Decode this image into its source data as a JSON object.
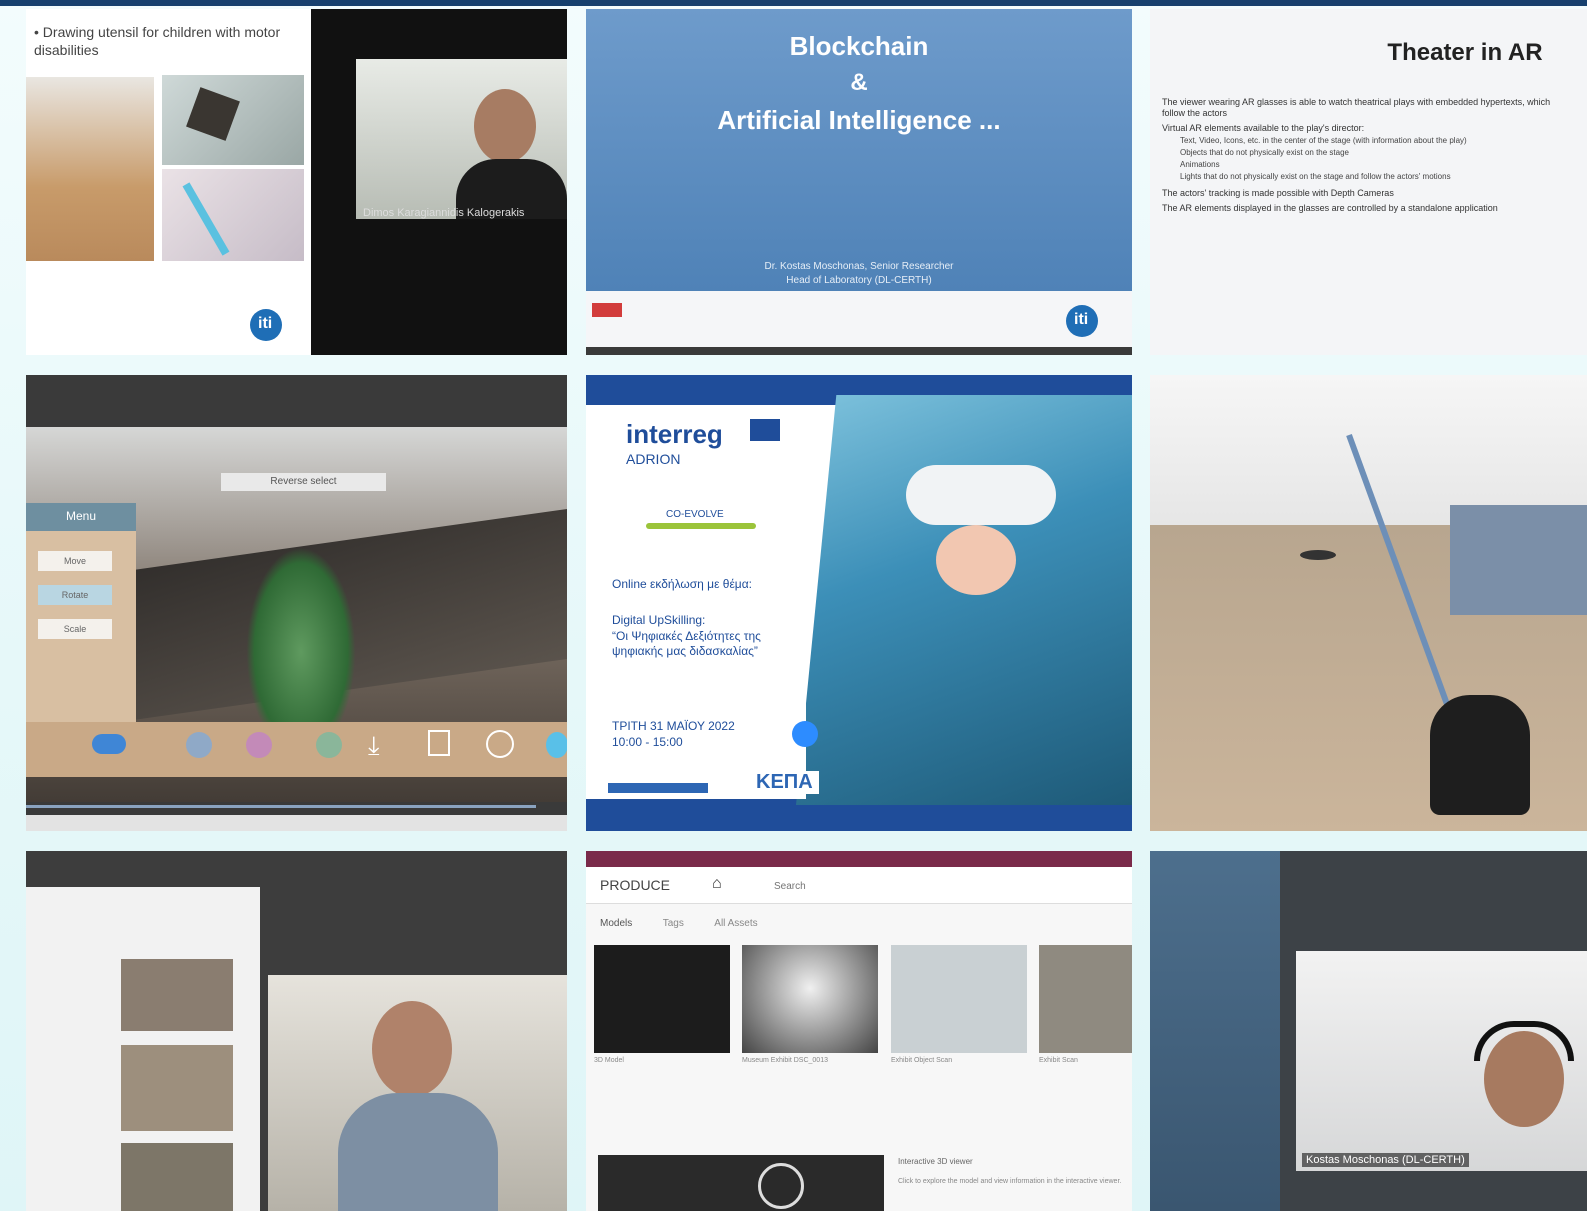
{
  "tiles": {
    "t1": {
      "slide_text": "• Drawing utensil for children with motor disabilities",
      "participant_name": "Dimos Karagiannidis Kalogerakis",
      "logo": "iti"
    },
    "t2": {
      "title_line1": "Blockchain",
      "title_line2": "&",
      "title_line3": "Artificial Intelligence ...",
      "presenter_line1": "Dr. Kostas Moschonas, Senior Researcher",
      "presenter_line2": "Head of Laboratory (DL-CERTH)",
      "logo": "iti"
    },
    "t3": {
      "title": "Theater in AR",
      "bullets": [
        "The viewer wearing AR glasses is able to watch theatrical plays with embedded hypertexts, which follow the actors",
        "Virtual AR elements available to the play's director:",
        "Text, Video, Icons, etc. in the center of the stage (with information about the play)",
        "Objects that do not physically exist on the stage",
        "Animations",
        "Lights that do not physically exist on the stage and follow the actors' motions",
        "The actors' tracking is made possible with Depth Cameras",
        "The AR elements displayed in the glasses are controlled by a standalone application"
      ]
    },
    "t4": {
      "ar_label": "Reverse select",
      "menu_title": "Menu",
      "menu_items": [
        "Move",
        "Rotate",
        "Scale"
      ]
    },
    "t5": {
      "brand": "interreg",
      "brand_sub": "ADRION",
      "project": "CO-EVOLVE",
      "event_line1": "Online εκδήλωση με θέμα:",
      "event_line2": "Digital UpSkilling:",
      "event_line3": "“Οι Ψηφιακές Δεξιότητες της ψηφιακής μας διδασκαλίας”",
      "date_line1": "ΤΡΙΤΗ 31 ΜΑΪΟΥ 2022",
      "date_line2": "10:00 - 15:00",
      "partner_logo": "ΚΕΠΑ"
    },
    "t8": {
      "app_name": "PRODUCE",
      "search_placeholder": "Search",
      "tabs": [
        "Models",
        "Tags",
        "All Assets"
      ],
      "captions": [
        "3D Model",
        "Museum Exhibit DSC_0013",
        "Exhibit Object Scan",
        "Exhibit Scan"
      ],
      "info_title": "Interactive 3D viewer",
      "info_text": "Click to explore the model and view information in the interactive viewer."
    },
    "t9": {
      "participant_name": "Kostas Moschonas (DL-CERTH)"
    }
  },
  "colors": {
    "topbar": "#17406e",
    "accent_blue": "#5b8dc0",
    "interreg_blue": "#1f4d9a"
  }
}
